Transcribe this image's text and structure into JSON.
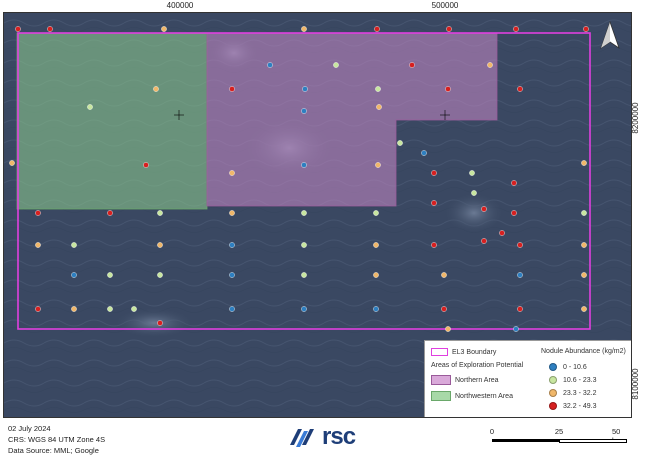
{
  "axis": {
    "x_ticks": [
      {
        "label": "400000"
      },
      {
        "label": "500000"
      }
    ],
    "y_ticks": [
      {
        "label": "8200000"
      },
      {
        "label": "8100000"
      }
    ]
  },
  "legend": {
    "boundary_label": "EL3 Boundary",
    "areas_title": "Areas of Exploration Potential",
    "northern_label": "Northern Area",
    "northwestern_label": "Northwestern Area",
    "abundance_title": "Nodule Abundance (kg/m2)",
    "classes": [
      {
        "label": "0 - 10.6",
        "color": "#2e7fc0"
      },
      {
        "label": "10.6 - 23.3",
        "color": "#c8e6a0"
      },
      {
        "label": "23.3 - 32.2",
        "color": "#f0b76a"
      },
      {
        "label": "32.2 - 49.3",
        "color": "#d62020"
      }
    ],
    "boundary_color": "#e040e0",
    "northern_color": "#d9a9d9",
    "northwestern_color": "#a8d9a8"
  },
  "footer": {
    "date": "02 July 2024",
    "crs": "CRS: WGS 84 UTM Zone 4S",
    "source": "Data Source: MML; Google"
  },
  "logo": {
    "text": "rsc"
  },
  "scale": {
    "labels": [
      "0",
      "25",
      "50 km"
    ]
  },
  "north_icon": "north-arrow-icon"
}
